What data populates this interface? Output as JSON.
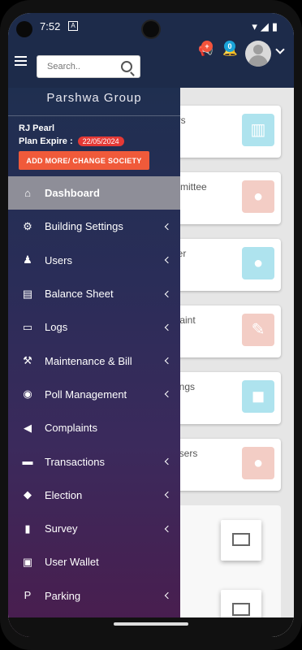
{
  "status_bar": {
    "time": "7:52",
    "notification_letter": "A"
  },
  "header": {
    "search_placeholder": "Search..",
    "announcement_badge": "+",
    "notification_badge": "0"
  },
  "drawer": {
    "org_name": "Parshwa Group",
    "society_name": "RJ Pearl",
    "plan_label": "Plan Expire :",
    "plan_date": "22/05/2024",
    "add_button_label": "ADD MORE/ CHANGE SOCIETY",
    "items": [
      {
        "label": "Dashboard",
        "icon": "home-icon",
        "glyph": "⌂",
        "submenu": false,
        "active": true
      },
      {
        "label": "Building Settings",
        "icon": "cogs-icon",
        "glyph": "⚙",
        "submenu": true
      },
      {
        "label": "Users",
        "icon": "user-icon",
        "glyph": "♟",
        "submenu": true
      },
      {
        "label": "Balance Sheet",
        "icon": "excel-file-icon",
        "glyph": "▤",
        "submenu": true
      },
      {
        "label": "Logs",
        "icon": "folder-icon",
        "glyph": "▭",
        "submenu": true
      },
      {
        "label": "Maintenance & Bill",
        "icon": "gavel-icon",
        "glyph": "⚒",
        "submenu": true
      },
      {
        "label": "Poll Management",
        "icon": "poll-icon",
        "glyph": "◉",
        "submenu": true
      },
      {
        "label": "Complaints",
        "icon": "bullhorn-icon",
        "glyph": "◀",
        "submenu": false
      },
      {
        "label": "Transactions",
        "icon": "credit-card-icon",
        "glyph": "▬",
        "submenu": true
      },
      {
        "label": "Election",
        "icon": "tags-icon",
        "glyph": "◆",
        "submenu": true
      },
      {
        "label": "Survey",
        "icon": "bar-chart-icon",
        "glyph": "▮",
        "submenu": true
      },
      {
        "label": "User Wallet",
        "icon": "wallet-icon",
        "glyph": "▣",
        "submenu": false
      },
      {
        "label": "Parking",
        "icon": "parking-icon",
        "glyph": "P",
        "submenu": true
      }
    ]
  },
  "cards": [
    {
      "title_fragment": "ors",
      "icon": "building-icon",
      "color": "teal"
    },
    {
      "title_fragment": "mmittee",
      "icon": "users-group-icon",
      "color": "salmon"
    },
    {
      "title_fragment": "ner",
      "icon": "users-icon",
      "color": "teal"
    },
    {
      "title_fragment": "plaint",
      "icon": "wrench-icon",
      "color": "salmon"
    },
    {
      "title_fragment": "kings",
      "icon": "car-icon",
      "color": "teal"
    },
    {
      "title_fragment": "Users",
      "icon": "apple-icon",
      "color": "salmon"
    }
  ],
  "colors": {
    "header": "#1d2b4a",
    "accent": "#f05a3a",
    "badge_red": "#f4543c",
    "badge_teal": "#1aa3d8"
  }
}
